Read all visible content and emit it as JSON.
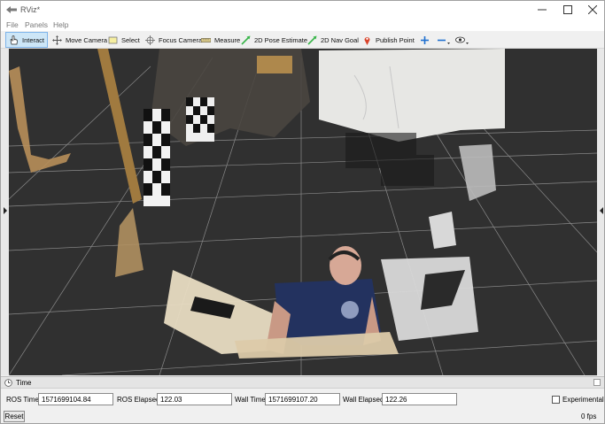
{
  "window": {
    "title": "RViz*"
  },
  "menu": {
    "items": [
      "File",
      "Panels",
      "Help"
    ]
  },
  "toolbar": {
    "tools": [
      {
        "label": "Interact",
        "icon": "cursor-hand-icon",
        "active": true
      },
      {
        "label": "Move Camera",
        "icon": "move-arrows-icon"
      },
      {
        "label": "Select",
        "icon": "select-box-icon"
      },
      {
        "label": "Focus Camera",
        "icon": "focus-crosshair-icon"
      },
      {
        "label": "Measure",
        "icon": "ruler-icon"
      },
      {
        "label": "2D Pose Estimate",
        "icon": "green-arrow-icon"
      },
      {
        "label": "2D Nav Goal",
        "icon": "green-arrow-icon"
      },
      {
        "label": "Publish Point",
        "icon": "map-pin-icon"
      }
    ],
    "extra_icons": [
      "plus-icon",
      "minus-icon",
      "eye-icon"
    ]
  },
  "time_panel": {
    "title": "Time",
    "ros_time_label": "ROS Time:",
    "ros_time_value": "1571699104.84",
    "ros_elapsed_label": "ROS Elapsed:",
    "ros_elapsed_value": "122.03",
    "wall_time_label": "Wall Time:",
    "wall_time_value": "1571699107.20",
    "wall_elapsed_label": "Wall Elapsed:",
    "wall_elapsed_value": "122.26",
    "experimental_label": "Experimental",
    "experimental_checked": false
  },
  "status": {
    "reset_label": "Reset",
    "fps_text": "0 fps"
  },
  "colors": {
    "viewport_background": "#303030",
    "grid": "#a0a0a0",
    "active_tool": "#cde6f7"
  }
}
